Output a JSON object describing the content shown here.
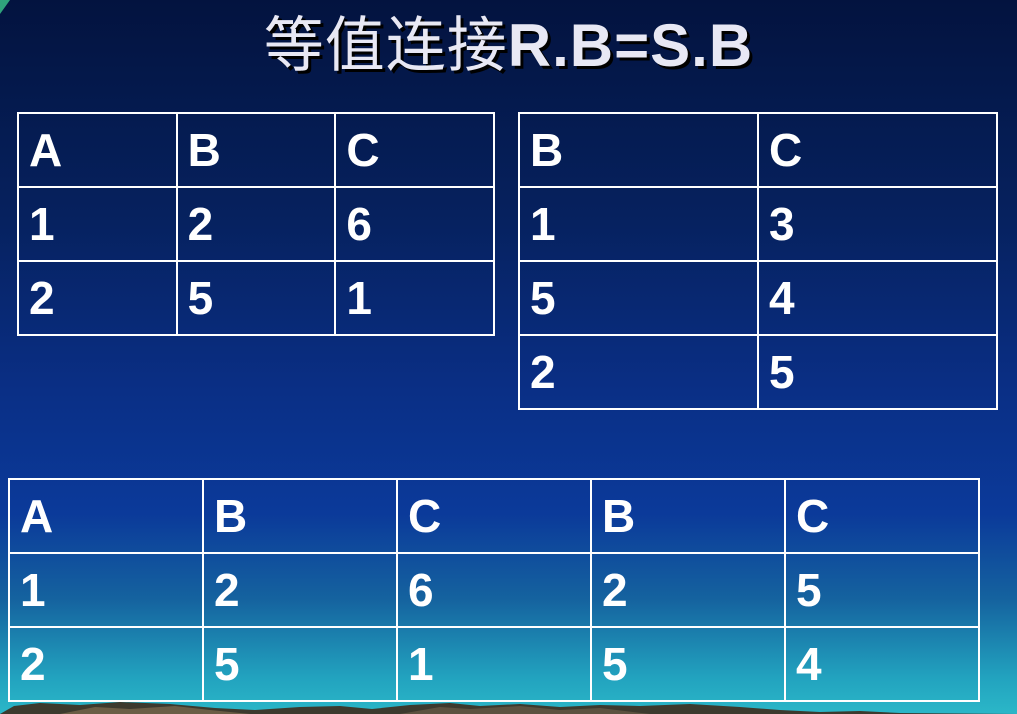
{
  "slide": {
    "title_cn": "等值连接",
    "title_en": "R.B=S.B"
  },
  "table_r": {
    "headers": [
      "A",
      "B",
      "C"
    ],
    "rows": [
      [
        "1",
        "2",
        "6"
      ],
      [
        "2",
        "5",
        "1"
      ]
    ]
  },
  "table_s": {
    "headers": [
      "B",
      "C"
    ],
    "rows": [
      [
        "1",
        "3"
      ],
      [
        "5",
        "4"
      ],
      [
        "2",
        "5"
      ]
    ]
  },
  "result": {
    "headers": [
      "A",
      "B",
      "C",
      "B",
      "C"
    ],
    "rows": [
      [
        "1",
        "2",
        "6",
        "2",
        "5"
      ],
      [
        "2",
        "5",
        "1",
        "5",
        "4"
      ]
    ]
  },
  "colors": {
    "background_top": "#03133f",
    "background_bottom": "#2bb7c8",
    "text": "#ffffff",
    "title_text": "#e8e8f4",
    "corner_accent": "#2fa37c"
  }
}
